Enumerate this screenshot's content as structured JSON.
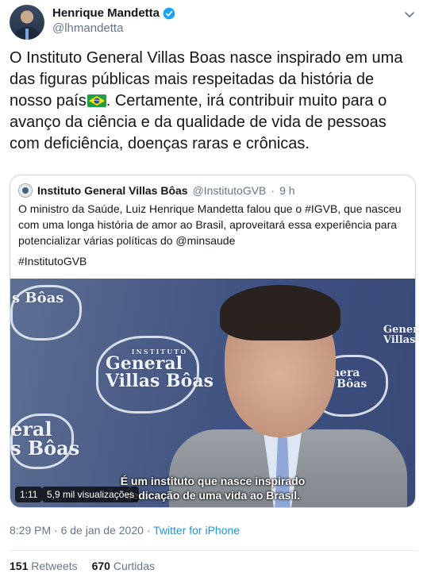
{
  "author": {
    "display_name": "Henrique Mandetta",
    "handle": "@lhmandetta",
    "verified": true,
    "avatar_icon": "profile-photo"
  },
  "tweet": {
    "text_part1": "O Instituto General Villas Boas nasce inspirado em uma das figuras públicas mais respeitadas da história de nosso país",
    "flag_icon": "brazil-flag-emoji",
    "text_part2": ". Certamente, irá contribuir muito para o avanço da ciência e da qualidade de vida de pessoas com deficiência, doenças raras e crônicas."
  },
  "quoted_tweet": {
    "display_name": "Instituto General Villas Bôas",
    "handle": "@InstitutoGVB",
    "separator": "·",
    "time_ago": "9 h",
    "text": "O ministro da Saúde, Luiz Henrique Mandetta falou que o #IGVB, que nasceu com uma longa história de amor ao Brasil, aproveitará essa experiência para potencializar várias políticas do @minsaude",
    "hashtag": "#InstitutoGVB",
    "video": {
      "duration": "1:11",
      "views": "5,9 mil visualizações",
      "caption_line1": "É um instituto que nasce inspirado",
      "caption_line2": "dedicação de uma vida ao Brasil.",
      "logo_small": "INSTITUTO",
      "logo_big1": "General",
      "logo_big2": "Villas Bôas",
      "logo_partial1": "eral",
      "logo_partial2": "s Bôas",
      "logo_partial3": "las Bôas",
      "logo_partial4": "Genera",
      "logo_partial5": "VillasB"
    }
  },
  "meta": {
    "time": "8:29 PM",
    "separator": "·",
    "date": "6 de jan de 2020",
    "source": "Twitter for iPhone"
  },
  "stats": {
    "retweets_count": "151",
    "retweets_label": "Retweets",
    "likes_count": "670",
    "likes_label": "Curtidas"
  },
  "colors": {
    "link": "#1b95e0",
    "secondary": "#657786",
    "verified": "#1da1f2"
  }
}
